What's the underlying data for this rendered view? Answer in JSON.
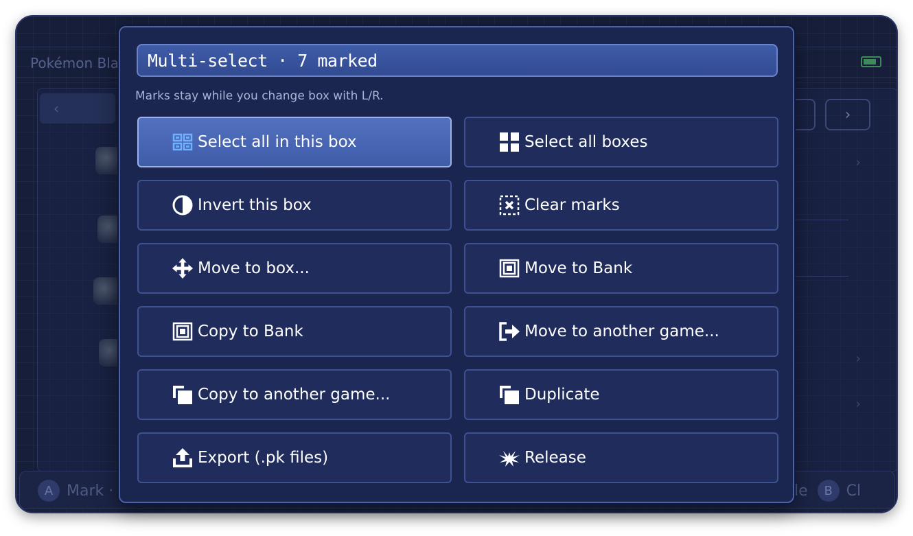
{
  "background": {
    "game_title": "Pokémon Bla",
    "box_nav_left": "‹",
    "nav_prev": "‹",
    "nav_next": "›",
    "footer": {
      "left_button": "A",
      "left_label": "Mark · H",
      "right_partial_label": "le",
      "right_button": "B",
      "right_label": "Cl"
    }
  },
  "modal": {
    "title": "Multi-select · 7 marked",
    "hint": "Marks stay while you change box with L/R.",
    "options": [
      {
        "label": "Select all in this box",
        "icon": "select-box-icon",
        "active": true
      },
      {
        "label": "Select all boxes",
        "icon": "grid-icon",
        "active": false
      },
      {
        "label": "Invert this box",
        "icon": "invert-icon",
        "active": false
      },
      {
        "label": "Clear marks",
        "icon": "clear-icon",
        "active": false
      },
      {
        "label": "Move to box...",
        "icon": "move-icon",
        "active": false
      },
      {
        "label": "Move to Bank",
        "icon": "bank-icon",
        "active": false
      },
      {
        "label": "Copy to Bank",
        "icon": "bank-icon",
        "active": false
      },
      {
        "label": "Move to another game...",
        "icon": "export-arrow-icon",
        "active": false
      },
      {
        "label": "Copy to another game...",
        "icon": "copy-icon",
        "active": false
      },
      {
        "label": "Duplicate",
        "icon": "copy-icon",
        "active": false
      },
      {
        "label": "Export (.pk files)",
        "icon": "upload-icon",
        "active": false
      },
      {
        "label": "Release",
        "icon": "release-icon",
        "active": false
      }
    ]
  },
  "colors": {
    "accent": "#3f5ca8",
    "modal_bg": "#1a2550",
    "battery": "#3e8a5a"
  }
}
